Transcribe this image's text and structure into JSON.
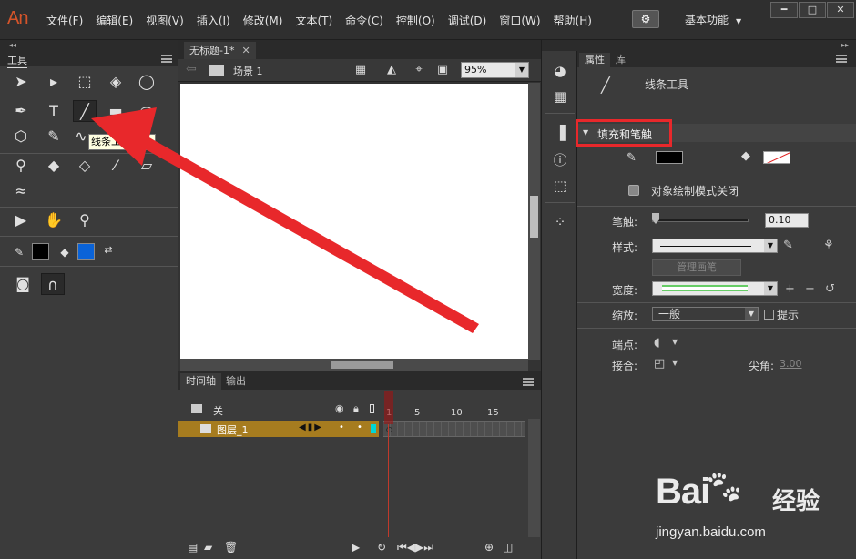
{
  "app": {
    "logo": "An"
  },
  "menu": {
    "items": [
      "文件(F)",
      "编辑(E)",
      "视图(V)",
      "插入(I)",
      "修改(M)",
      "文本(T)",
      "命令(C)",
      "控制(O)",
      "调试(D)",
      "窗口(W)",
      "帮助(H)"
    ],
    "workspace": "基本功能"
  },
  "tools_panel": {
    "title": "工具",
    "tooltip": "线条工具"
  },
  "document": {
    "tab_title": "无标题-1*",
    "scene": "场景 1",
    "zoom": "95%"
  },
  "timeline": {
    "tabs": [
      "时间轴",
      "输出"
    ],
    "header_label": "关",
    "layer_name": "图层_1",
    "ruler": [
      "1",
      "5",
      "10",
      "15"
    ]
  },
  "properties": {
    "tabs": [
      "属性",
      "库"
    ],
    "tool_name": "线条工具",
    "section_title": "填充和笔触",
    "object_draw_mode": "对象绘制模式关闭",
    "stroke_label": "笔触:",
    "stroke_value": "0.10",
    "style_label": "样式:",
    "manage_brush": "管理画笔",
    "width_label": "宽度:",
    "scale_label": "缩放:",
    "scale_value": "一般",
    "hint_label": "提示",
    "cap_label": "端点:",
    "join_label": "接合:",
    "miter_label": "尖角:",
    "miter_value": "3.00",
    "colors": {
      "stroke": "#000000",
      "highlight": "#e8282b"
    }
  },
  "watermark": {
    "brand": "Bai",
    "brand_cn": "经验",
    "url": "jingyan.baidu.com"
  }
}
